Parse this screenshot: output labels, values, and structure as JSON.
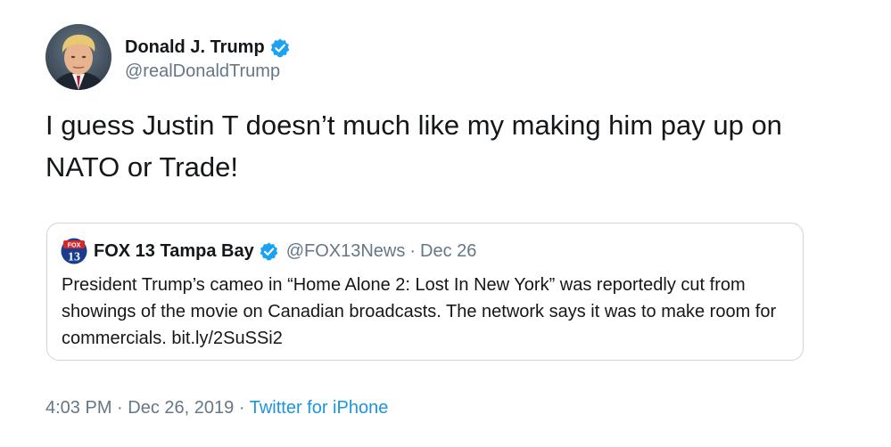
{
  "author": {
    "display_name": "Donald J. Trump",
    "handle": "@realDonaldTrump",
    "verified": true
  },
  "tweet": {
    "text": "I guess Justin T doesn’t much like my making him pay up on NATO or Trade!"
  },
  "quoted_tweet": {
    "logo_text": "13",
    "logo_top_text": "FOX",
    "display_name": "FOX 13 Tampa Bay",
    "handle": "@FOX13News",
    "separator": "·",
    "date": "Dec 26",
    "verified": true,
    "text": "President Trump’s cameo in “Home Alone 2: Lost In New York” was reportedly cut from showings of the movie on Canadian broadcasts. The network says it was to make room for commercials. bit.ly/2SuSSi2"
  },
  "meta": {
    "time": "4:03 PM",
    "separator": "·",
    "date": "Dec 26, 2019",
    "source": "Twitter for iPhone"
  },
  "colors": {
    "text": "#14171a",
    "secondary": "#657786",
    "link": "#1b95e0",
    "verified_badge": "#1da1f2",
    "border": "#ccd6dd",
    "fox_blue": "#1a3d8f",
    "fox_red": "#d62828"
  }
}
